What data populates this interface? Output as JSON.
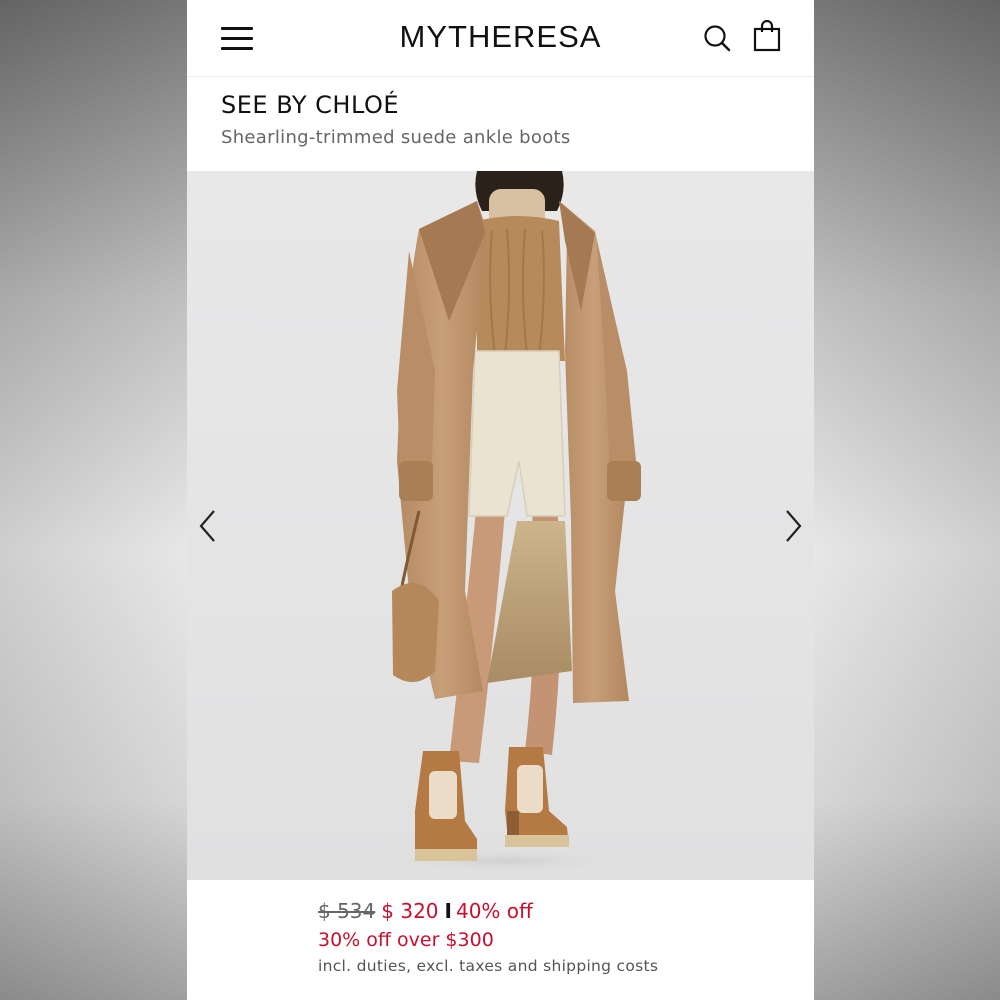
{
  "header": {
    "logo": "MYTHERESA",
    "icons": [
      "menu-icon",
      "search-icon",
      "shopping-bag-icon"
    ]
  },
  "product": {
    "brand": "SEE BY CHLOÉ",
    "name": "Shearling-trimmed suede ankle boots"
  },
  "gallery": {
    "icons": [
      "chevron-left-icon",
      "chevron-right-icon"
    ]
  },
  "pricing": {
    "original_price": "$ 534",
    "sale_price": "$ 320",
    "separator": "I",
    "discount": "40% off",
    "promo": "30% off over $300",
    "duties_note": "incl. duties, excl. taxes and shipping costs"
  },
  "colors": {
    "sale_red": "#c8102e",
    "text_dark": "#111111",
    "text_muted": "#666666"
  }
}
